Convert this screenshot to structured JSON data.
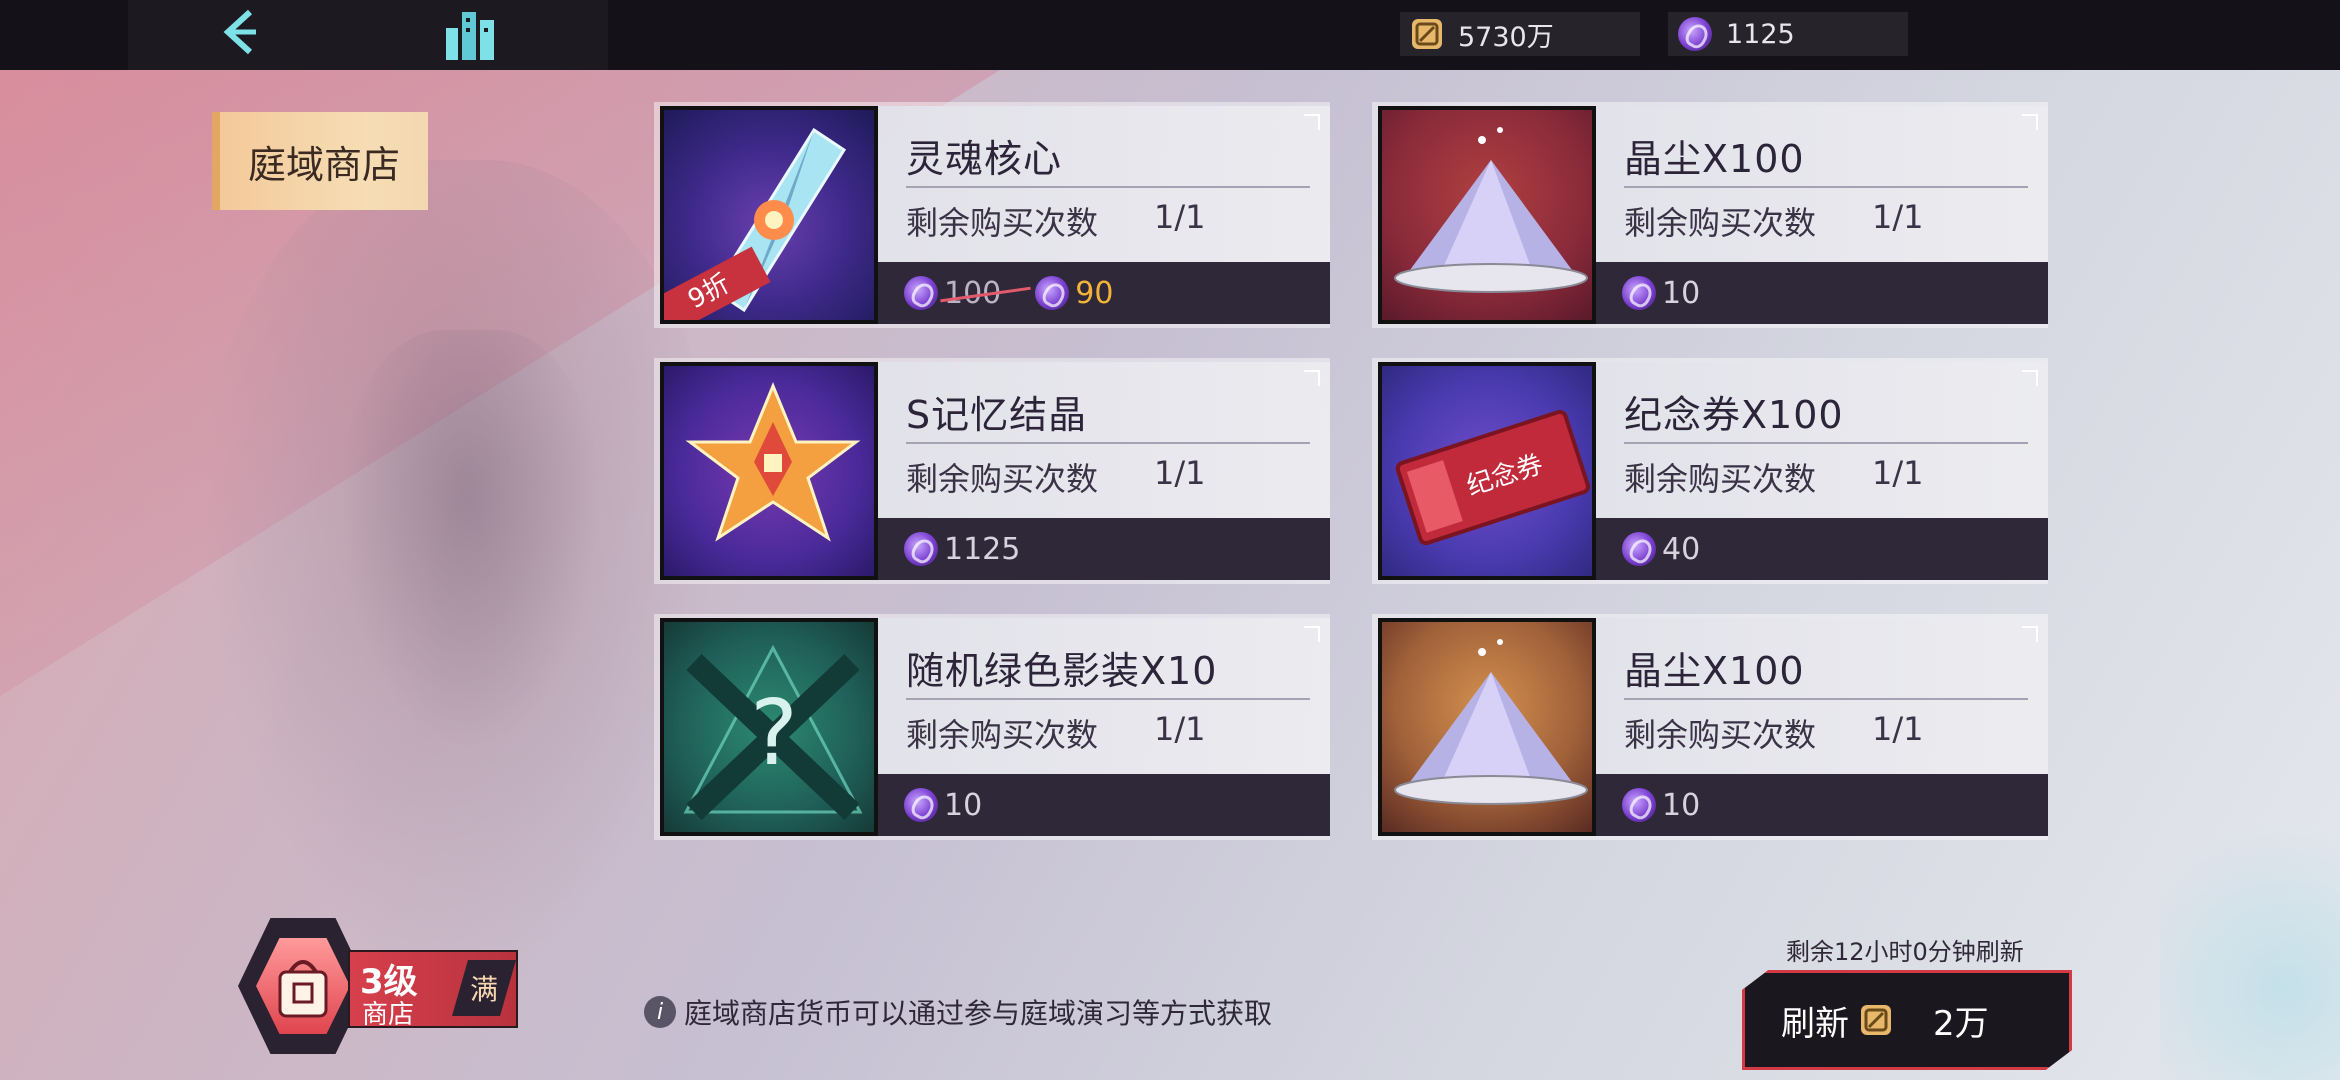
{
  "topbar": {
    "currency_gold": "5730万",
    "currency_purple": "1125"
  },
  "shop": {
    "title": "庭域商店"
  },
  "items": [
    {
      "name": "灵魂核心",
      "remain_label": "剩余购买次数",
      "remain": "1/1",
      "old_price": "100",
      "price": "90",
      "discount": "9折"
    },
    {
      "name": "晶尘X100",
      "remain_label": "剩余购买次数",
      "remain": "1/1",
      "price": "10"
    },
    {
      "name": "S记忆结晶",
      "remain_label": "剩余购买次数",
      "remain": "1/1",
      "price": "1125"
    },
    {
      "name": "纪念券X100",
      "remain_label": "剩余购买次数",
      "remain": "1/1",
      "price": "40",
      "ticket_text": "纪念券"
    },
    {
      "name": "随机绿色影装X10",
      "remain_label": "剩余购买次数",
      "remain": "1/1",
      "price": "10"
    },
    {
      "name": "晶尘X100",
      "remain_label": "剩余购买次数",
      "remain": "1/1",
      "price": "10"
    }
  ],
  "bottom": {
    "level_main": "3级",
    "level_sub": "商店",
    "level_full": "满",
    "tip": "庭域商店货币可以通过参与庭域演习等方式获取",
    "refresh_timer": "剩余12小时0分钟刷新",
    "refresh_label": "刷新",
    "refresh_cost": "2万"
  }
}
